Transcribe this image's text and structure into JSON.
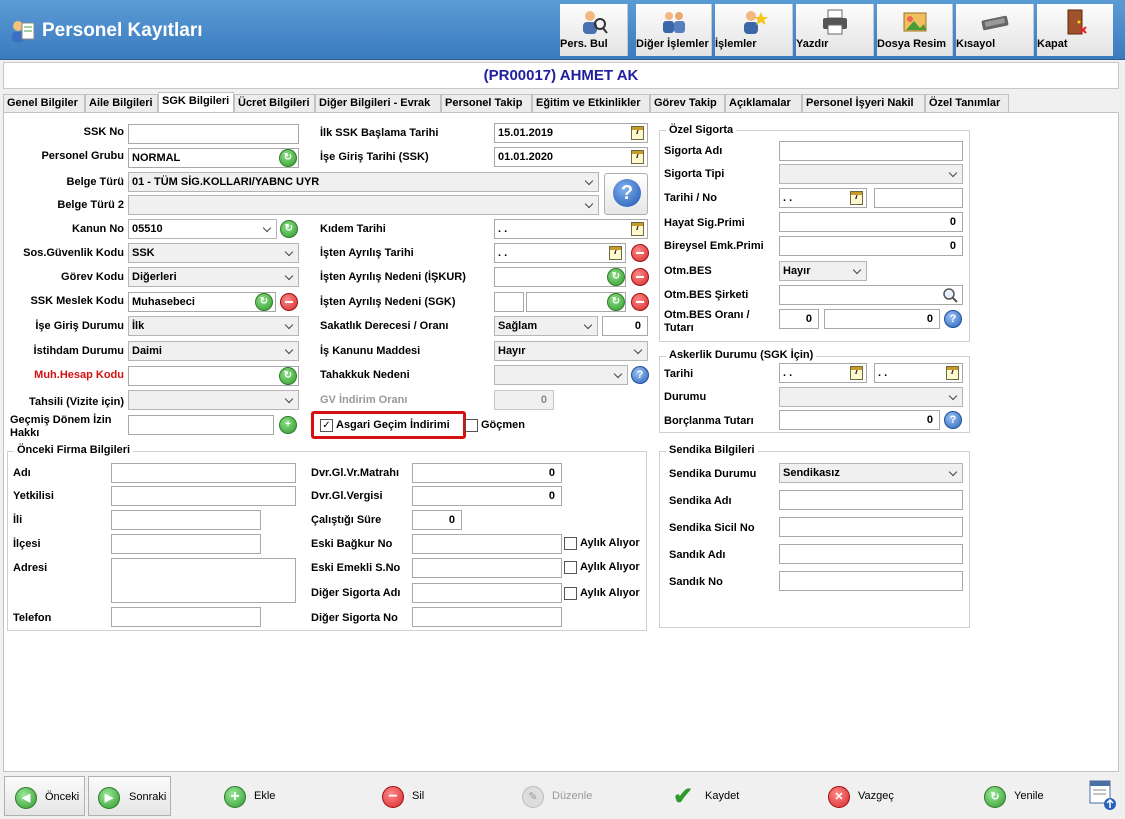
{
  "app": {
    "title": "Personel Kayıtları",
    "record_header": "(PR00017) AHMET AK"
  },
  "toolbar": [
    {
      "label": "Pers. Bul",
      "icon": "person-search-icon"
    },
    {
      "label": "Diğer İşlemler",
      "icon": "people-icon"
    },
    {
      "label": "İşlemler",
      "icon": "person-star-icon"
    },
    {
      "label": "Yazdır",
      "icon": "printer-icon"
    },
    {
      "label": "Dosya Resim",
      "icon": "image-file-icon"
    },
    {
      "label": "Kısayol",
      "icon": "keyboard-icon"
    },
    {
      "label": "Kapat",
      "icon": "door-exit-icon"
    }
  ],
  "tabs": [
    "Genel Bilgiler",
    "Aile Bilgileri",
    "SGK Bilgileri",
    "Ücret Bilgileri",
    "Diğer Bilgileri - Evrak",
    "Personel Takip",
    "Eğitim ve Etkinlikler",
    "Görev Takip",
    "Açıklamalar",
    "Personel İşyeri Nakil",
    "Özel Tanımlar"
  ],
  "left": {
    "ssk_no": {
      "label": "SSK No",
      "value": ""
    },
    "personel_grubu": {
      "label": "Personel Grubu",
      "value": "NORMAL"
    },
    "belge_turu": {
      "label": "Belge Türü",
      "value": "01 - TÜM SİG.KOLLARI/YABNC UYR"
    },
    "belge_turu2": {
      "label": "Belge Türü 2",
      "value": ""
    },
    "kanun_no": {
      "label": "Kanun No",
      "value": "05510"
    },
    "sos_guvenlik": {
      "label": "Sos.Güvenlik Kodu",
      "value": "SSK"
    },
    "gorev_kodu": {
      "label": "Görev Kodu",
      "value": "Diğerleri"
    },
    "ssk_meslek": {
      "label": "SSK Meslek Kodu",
      "value": "Muhasebeci"
    },
    "ise_giris_durumu": {
      "label": "İşe Giriş Durumu",
      "value": "İlk"
    },
    "istihdam": {
      "label": "İstihdam Durumu",
      "value": "Daimi"
    },
    "muh_hesap": {
      "label": "Muh.Hesap Kodu",
      "value": ""
    },
    "tahsili": {
      "label": "Tahsili (Vizite için)",
      "value": ""
    },
    "gecmis_donem": {
      "label1": "Geçmiş Dönem İzin",
      "label2": "Hakkı",
      "value": ""
    }
  },
  "mid": {
    "ilk_ssk": {
      "label": "İlk SSK Başlama Tarihi",
      "value": "15.01.2019"
    },
    "ise_giris_tarihi": {
      "label": "İşe Giriş Tarihi (SSK)",
      "value": "01.01.2020"
    },
    "kidem": {
      "label": "Kıdem Tarihi",
      "value": ". ."
    },
    "isten_ayrilis": {
      "label": "İşten Ayrılış Tarihi",
      "value": ". ."
    },
    "ayrilis_iskur": {
      "label": "İşten Ayrılış Nedeni (İŞKUR)",
      "value": ""
    },
    "ayrilis_sgk": {
      "label": "İşten Ayrılış Nedeni (SGK)",
      "value": ""
    },
    "sakatlik": {
      "label": "Sakatlık Derecesi / Oranı",
      "value": "Sağlam",
      "oran": "0"
    },
    "is_kanunu": {
      "label": "İş Kanunu Maddesi",
      "value": "Hayır"
    },
    "tahakkuk": {
      "label": "Tahakkuk Nedeni",
      "value": ""
    },
    "gv_indirim": {
      "label": "GV İndirim Oranı",
      "value": "0"
    },
    "asgari": {
      "label": "Asgari Geçim İndirimi",
      "checked": true
    },
    "gocmen": {
      "label": "Göçmen",
      "checked": false
    },
    "help_icon": "help-icon"
  },
  "onceki": {
    "title": "Önceki Firma Bilgileri",
    "adi": "Adı",
    "yetkilisi": "Yetkilisi",
    "ili": "İli",
    "ilcesi": "İlçesi",
    "adresi": "Adresi",
    "telefon": "Telefon",
    "matrah": {
      "label": "Dvr.Gl.Vr.Matrahı",
      "value": "0"
    },
    "vergisi": {
      "label": "Dvr.Gl.Vergisi",
      "value": "0"
    },
    "calistigi": {
      "label": "Çalıştığı Süre",
      "value": "0"
    },
    "bagkur": "Eski Bağkur No",
    "emekli": "Eski Emekli S.No",
    "dsa": "Diğer Sigorta Adı",
    "dsn": "Diğer Sigorta No",
    "aylik": "Aylık Alıyor"
  },
  "ozel": {
    "title": "Özel Sigorta",
    "sigorta_adi": {
      "label": "Sigorta Adı",
      "value": ""
    },
    "sigorta_tipi": {
      "label": "Sigorta Tipi",
      "value": ""
    },
    "tarihi_no": {
      "label": "Tarihi / No",
      "value": ". ."
    },
    "hayat": {
      "label": "Hayat Sig.Primi",
      "value": "0"
    },
    "bireysel": {
      "label": "Bireysel Emk.Primi",
      "value": "0"
    },
    "otm_bes": {
      "label": "Otm.BES",
      "value": "Hayır"
    },
    "otm_sirket": {
      "label": "Otm.BES Şirketi",
      "value": ""
    },
    "otm_oran": {
      "label1": "Otm.BES Oranı /",
      "label2": "Tutarı",
      "oran": "0",
      "tutar": "0"
    }
  },
  "asker": {
    "title": "Askerlik Durumu (SGK İçin)",
    "tarihi": {
      "label": "Tarihi",
      "v1": ". .",
      "v2": ". ."
    },
    "durumu": {
      "label": "Durumu",
      "value": ""
    },
    "borclanma": {
      "label": "Borçlanma Tutarı",
      "value": "0"
    }
  },
  "sendika": {
    "title": "Sendika Bilgileri",
    "durumu": {
      "label": "Sendika Durumu",
      "value": "Sendikasız"
    },
    "adi": "Sendika Adı",
    "sicil": "Sendika Sicil No",
    "sandik_adi": "Sandık Adı",
    "sandik_no": "Sandık No"
  },
  "footer": {
    "onceki": "Önceki",
    "sonraki": "Sonraki",
    "ekle": "Ekle",
    "sil": "Sil",
    "duzenle": "Düzenle",
    "kaydet": "Kaydet",
    "vazgec": "Vazgeç",
    "yenile": "Yenile"
  }
}
